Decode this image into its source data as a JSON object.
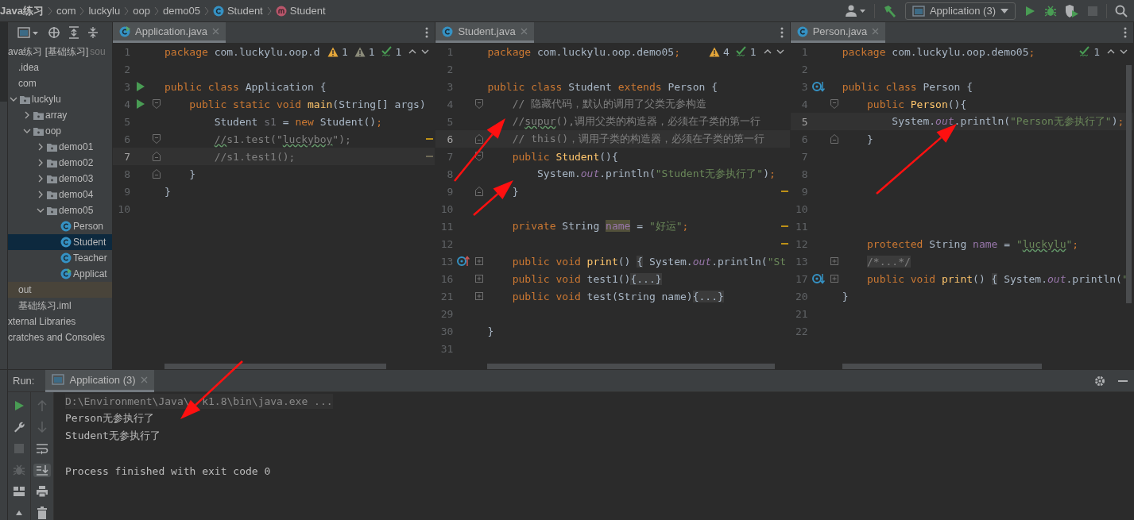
{
  "nav_bar": {
    "breadcrumbs": [
      {
        "label": "Java练习",
        "kind": "project"
      },
      {
        "label": "com",
        "kind": "package"
      },
      {
        "label": "luckylu",
        "kind": "package"
      },
      {
        "label": "oop",
        "kind": "package"
      },
      {
        "label": "demo05",
        "kind": "package"
      },
      {
        "label": "Student",
        "kind": "class"
      },
      {
        "label": "Student",
        "kind": "method"
      }
    ],
    "run_config": "Application (3)",
    "buttons": [
      {
        "kind": "run",
        "disabled": false
      },
      {
        "kind": "debug",
        "disabled": false
      },
      {
        "kind": "coverage",
        "disabled": false
      },
      {
        "kind": "stop",
        "disabled": true
      }
    ]
  },
  "project_tree": [
    {
      "label": "ava练习 [基础练习]",
      "location": "sou",
      "selected": false,
      "children": [
        {
          "label": ".idea",
          "kind": "folder",
          "selected": false
        },
        {
          "label": "com",
          "kind": "folder",
          "selected": false,
          "children": [
            {
              "label": "luckylu",
              "kind": "package",
              "expanded": true,
              "selected": false,
              "children": [
                {
                  "label": "array",
                  "kind": "package",
                  "expanded": false,
                  "selected": false
                },
                {
                  "label": "oop",
                  "kind": "package",
                  "expanded": true,
                  "selected": false,
                  "children": [
                    {
                      "label": "demo01",
                      "kind": "package",
                      "expanded": false,
                      "selected": false
                    },
                    {
                      "label": "demo02",
                      "kind": "package",
                      "expanded": false,
                      "selected": false
                    },
                    {
                      "label": "demo03",
                      "kind": "package",
                      "expanded": false,
                      "selected": false
                    },
                    {
                      "label": "demo04",
                      "kind": "package",
                      "expanded": false,
                      "selected": false
                    },
                    {
                      "label": "demo05",
                      "kind": "package",
                      "expanded": true,
                      "selected": false,
                      "children": [
                        {
                          "label": "Person",
                          "kind": "class",
                          "selected": false
                        },
                        {
                          "label": "Student",
                          "kind": "class",
                          "selected": true
                        },
                        {
                          "label": "Teacher",
                          "kind": "class",
                          "selected": false
                        },
                        {
                          "label": "Applicat",
                          "kind": "main-class",
                          "selected": false
                        }
                      ]
                    }
                  ]
                }
              ]
            }
          ]
        },
        {
          "label": "out",
          "kind": "excluded",
          "selected": false
        },
        {
          "label": "基础练习.iml",
          "kind": "file",
          "selected": false
        }
      ]
    },
    {
      "label": "xternal Libraries",
      "selected": false
    },
    {
      "label": "cratches and Consoles",
      "selected": false
    }
  ],
  "editors": [
    {
      "tab": {
        "label": "Application.java",
        "kind": "main-class",
        "selected": true
      },
      "inspections": [
        {
          "kind": "warning",
          "count": "1"
        },
        {
          "kind": "weak",
          "count": "1"
        },
        {
          "kind": "typo",
          "count": "1"
        }
      ],
      "lines": [
        {
          "number": "1",
          "current": false,
          "tokens": [
            {
              "text": "package",
              "kind": "keyword"
            },
            {
              "text": " com.luckylu.oop.d",
              "kind": "text"
            }
          ]
        },
        {
          "number": "2",
          "current": false
        },
        {
          "number": "3",
          "current": false,
          "gutter": {
            "kind": "run"
          },
          "tokens": [
            {
              "text": "public class ",
              "kind": "keyword"
            },
            {
              "text": "Application {",
              "kind": "text"
            }
          ]
        },
        {
          "number": "4",
          "current": false,
          "gutter": {
            "kind": "run"
          },
          "fold": {
            "kind": "start"
          },
          "tokens": [
            {
              "text": "    public static void ",
              "kind": "keyword"
            },
            {
              "text": "main",
              "kind": "method"
            },
            {
              "text": "(String[] args)",
              "kind": "text"
            }
          ]
        },
        {
          "number": "5",
          "current": false,
          "tokens": [
            {
              "text": "        Student ",
              "kind": "text"
            },
            {
              "text": "s1",
              "kind": "unused"
            },
            {
              "text": " = ",
              "kind": "text"
            },
            {
              "text": "new",
              "kind": "keyword"
            },
            {
              "text": " Student()",
              "kind": "text"
            },
            {
              "text": ";",
              "kind": "keyword"
            }
          ]
        },
        {
          "number": "6",
          "current": false,
          "fold": {
            "kind": "start"
          },
          "stripe": {
            "kind": "warning"
          },
          "tokens": [
            {
              "text": "        //",
              "kind": "comment-typo"
            },
            {
              "text": "s1.test(\"",
              "kind": "comment"
            },
            {
              "text": "luckyboy",
              "kind": "comment-typo"
            },
            {
              "text": "\");",
              "kind": "comment"
            }
          ]
        },
        {
          "number": "7",
          "current": true,
          "fold": {
            "kind": "end"
          },
          "stripe": {
            "kind": "note"
          },
          "tokens": [
            {
              "text": "        //s1.test1();",
              "kind": "comment"
            }
          ]
        },
        {
          "number": "8",
          "current": false,
          "fold": {
            "kind": "end"
          },
          "tokens": [
            {
              "text": "    }",
              "kind": "text"
            }
          ]
        },
        {
          "number": "9",
          "current": false,
          "tokens": [
            {
              "text": "}",
              "kind": "text"
            }
          ]
        },
        {
          "number": "10",
          "current": false
        }
      ]
    },
    {
      "tab": {
        "label": "Student.java",
        "kind": "class",
        "selected": true
      },
      "inspections": [
        {
          "kind": "warning",
          "count": "4"
        },
        {
          "kind": "typo",
          "count": "1"
        }
      ],
      "lines": [
        {
          "number": "1",
          "current": false,
          "tokens": [
            {
              "text": "package",
              "kind": "keyword"
            },
            {
              "text": " com.luckylu.oop.demo05",
              "kind": "text"
            },
            {
              "text": ";",
              "kind": "keyword"
            }
          ]
        },
        {
          "number": "2",
          "current": false
        },
        {
          "number": "3",
          "current": false,
          "tokens": [
            {
              "text": "public class ",
              "kind": "keyword"
            },
            {
              "text": "Student ",
              "kind": "text"
            },
            {
              "text": "extends ",
              "kind": "keyword"
            },
            {
              "text": "Person {",
              "kind": "text"
            }
          ]
        },
        {
          "number": "4",
          "current": false,
          "fold": {
            "kind": "start"
          },
          "tokens": [
            {
              "text": "    // 隐藏代码，默认的调用了父类无参构造",
              "kind": "comment"
            }
          ]
        },
        {
          "number": "5",
          "current": false,
          "tokens": [
            {
              "text": "    //",
              "kind": "comment"
            },
            {
              "text": "supur",
              "kind": "comment-typo"
            },
            {
              "text": "(),调用父类的构造器，必须在子类的第一行",
              "kind": "comment"
            }
          ]
        },
        {
          "number": "6",
          "current": true,
          "fold": {
            "kind": "end"
          },
          "tokens": [
            {
              "text": "    // this()，调用子类的构造器，必须在子类的第一行",
              "kind": "comment"
            }
          ]
        },
        {
          "number": "7",
          "current": false,
          "fold": {
            "kind": "start"
          },
          "tokens": [
            {
              "text": "    public ",
              "kind": "keyword"
            },
            {
              "text": "Student",
              "kind": "method"
            },
            {
              "text": "(){",
              "kind": "text"
            }
          ]
        },
        {
          "number": "8",
          "current": false,
          "tokens": [
            {
              "text": "        System.",
              "kind": "text"
            },
            {
              "text": "out",
              "kind": "field"
            },
            {
              "text": ".println(",
              "kind": "text"
            },
            {
              "text": "\"Student无参执行了\"",
              "kind": "string"
            },
            {
              "text": ")",
              "kind": "text"
            },
            {
              "text": ";",
              "kind": "keyword"
            }
          ]
        },
        {
          "number": "9",
          "current": false,
          "fold": {
            "kind": "end"
          },
          "stripe": {
            "kind": "warning"
          },
          "tokens": [
            {
              "text": "    }",
              "kind": "text"
            }
          ]
        },
        {
          "number": "10",
          "current": false
        },
        {
          "number": "11",
          "current": false,
          "stripe": {
            "kind": "warning"
          },
          "tokens": [
            {
              "text": "    private ",
              "kind": "keyword"
            },
            {
              "text": "String ",
              "kind": "text"
            },
            {
              "text": "name",
              "kind": "member-usage"
            },
            {
              "text": " = ",
              "kind": "text"
            },
            {
              "text": "\"好运\"",
              "kind": "string"
            },
            {
              "text": ";",
              "kind": "keyword"
            }
          ]
        },
        {
          "number": "12",
          "current": false,
          "stripe": {
            "kind": "warning"
          }
        },
        {
          "number": "13",
          "current": false,
          "gutter": {
            "kind": "override-up"
          },
          "fold": {
            "kind": "collapsed"
          },
          "tokens": [
            {
              "text": "    public void ",
              "kind": "keyword"
            },
            {
              "text": "print",
              "kind": "method"
            },
            {
              "text": "() ",
              "kind": "text"
            },
            {
              "text": "{",
              "kind": "text-folded"
            },
            {
              "text": " System.",
              "kind": "text"
            },
            {
              "text": "out",
              "kind": "field"
            },
            {
              "text": ".println(",
              "kind": "text"
            },
            {
              "text": "\"St",
              "kind": "string"
            }
          ]
        },
        {
          "number": "16",
          "current": false,
          "fold": {
            "kind": "collapsed"
          },
          "tokens": [
            {
              "text": "    public void ",
              "kind": "keyword"
            },
            {
              "text": "test1()",
              "kind": "text"
            },
            {
              "text": "{...}",
              "kind": "placeholder-folded"
            }
          ]
        },
        {
          "number": "21",
          "current": false,
          "fold": {
            "kind": "collapsed"
          },
          "tokens": [
            {
              "text": "    public void ",
              "kind": "keyword"
            },
            {
              "text": "test(String name)",
              "kind": "text"
            },
            {
              "text": "{...}",
              "kind": "placeholder-folded"
            }
          ]
        },
        {
          "number": "29",
          "current": false
        },
        {
          "number": "30",
          "current": false,
          "tokens": [
            {
              "text": "}",
              "kind": "text"
            }
          ]
        },
        {
          "number": "31",
          "current": false
        }
      ]
    },
    {
      "tab": {
        "label": "Person.java",
        "kind": "class",
        "selected": true
      },
      "inspections": [
        {
          "kind": "typo",
          "count": "1"
        }
      ],
      "lines": [
        {
          "number": "1",
          "current": false,
          "tokens": [
            {
              "text": "package",
              "kind": "keyword"
            },
            {
              "text": " com.luckylu.oop.demo05",
              "kind": "text"
            },
            {
              "text": ";",
              "kind": "keyword"
            }
          ]
        },
        {
          "number": "2",
          "current": false
        },
        {
          "number": "3",
          "current": false,
          "gutter": {
            "kind": "override-down"
          },
          "tokens": [
            {
              "text": "public class ",
              "kind": "keyword"
            },
            {
              "text": "Person {",
              "kind": "text"
            }
          ]
        },
        {
          "number": "4",
          "current": false,
          "fold": {
            "kind": "start"
          },
          "tokens": [
            {
              "text": "    public ",
              "kind": "keyword"
            },
            {
              "text": "Person",
              "kind": "method"
            },
            {
              "text": "(){",
              "kind": "text"
            }
          ]
        },
        {
          "number": "5",
          "current": true,
          "tokens": [
            {
              "text": "        System.",
              "kind": "text"
            },
            {
              "text": "out",
              "kind": "field"
            },
            {
              "text": ".println(",
              "kind": "text"
            },
            {
              "text": "\"Person无参执行了\"",
              "kind": "string"
            },
            {
              "text": ")",
              "kind": "text"
            },
            {
              "text": ";",
              "kind": "keyword"
            }
          ]
        },
        {
          "number": "6",
          "current": false,
          "fold": {
            "kind": "end"
          },
          "tokens": [
            {
              "text": "    }",
              "kind": "text"
            }
          ]
        },
        {
          "number": "7",
          "current": false
        },
        {
          "number": "8",
          "current": false
        },
        {
          "number": "9",
          "current": false
        },
        {
          "number": "10",
          "current": false
        },
        {
          "number": "11",
          "current": false
        },
        {
          "number": "12",
          "current": false,
          "tokens": [
            {
              "text": "    protected ",
              "kind": "keyword"
            },
            {
              "text": "String ",
              "kind": "text"
            },
            {
              "text": "name",
              "kind": "member"
            },
            {
              "text": " = ",
              "kind": "text"
            },
            {
              "text": "\"",
              "kind": "string"
            },
            {
              "text": "luckylu",
              "kind": "string-typo"
            },
            {
              "text": "\"",
              "kind": "string"
            },
            {
              "text": ";",
              "kind": "keyword"
            }
          ]
        },
        {
          "number": "13",
          "current": false,
          "fold": {
            "kind": "collapsed"
          },
          "tokens": [
            {
              "text": "    /*...*/",
              "kind": "comment-folded"
            }
          ]
        },
        {
          "number": "17",
          "current": false,
          "gutter": {
            "kind": "override-down"
          },
          "fold": {
            "kind": "collapsed"
          },
          "tokens": [
            {
              "text": "    public void ",
              "kind": "keyword"
            },
            {
              "text": "print",
              "kind": "method"
            },
            {
              "text": "() ",
              "kind": "text"
            },
            {
              "text": "{",
              "kind": "text-folded"
            },
            {
              "text": " System.",
              "kind": "text"
            },
            {
              "text": "out",
              "kind": "field"
            },
            {
              "text": ".println(",
              "kind": "text"
            },
            {
              "text": "\"",
              "kind": "string"
            }
          ]
        },
        {
          "number": "20",
          "current": false,
          "tokens": [
            {
              "text": "}",
              "kind": "text"
            }
          ]
        },
        {
          "number": "21",
          "current": false
        },
        {
          "number": "22",
          "current": false
        }
      ]
    }
  ],
  "run_panel": {
    "label": "Run:",
    "tab": {
      "label": "Application (3)",
      "selected": true
    },
    "tools_left": [
      {
        "kind": "rerun",
        "disabled": false
      },
      {
        "kind": "wrench",
        "disabled": false
      },
      {
        "kind": "stop",
        "disabled": true
      },
      {
        "kind": "debug",
        "disabled": true
      },
      {
        "kind": "layout",
        "disabled": false
      },
      {
        "kind": "pin",
        "disabled": false
      }
    ],
    "tools_right": [
      {
        "kind": "up",
        "disabled": true,
        "on": false
      },
      {
        "kind": "down",
        "disabled": true,
        "on": false
      },
      {
        "kind": "wrap",
        "disabled": false,
        "on": false
      },
      {
        "kind": "scroll-end",
        "disabled": false,
        "on": true
      },
      {
        "kind": "print",
        "disabled": false,
        "on": false
      },
      {
        "kind": "trash",
        "disabled": false,
        "on": false
      }
    ],
    "console": [
      {
        "kind": "command",
        "parts": [
          "D:\\Environment\\Java\\",
          "k1.8\\bin\\java.exe ..."
        ]
      },
      {
        "kind": "output",
        "text": "Person无参执行了"
      },
      {
        "kind": "output",
        "text": "Student无参执行了"
      },
      {
        "kind": "blank"
      },
      {
        "kind": "output",
        "text": "Process finished with exit code 0"
      }
    ]
  }
}
